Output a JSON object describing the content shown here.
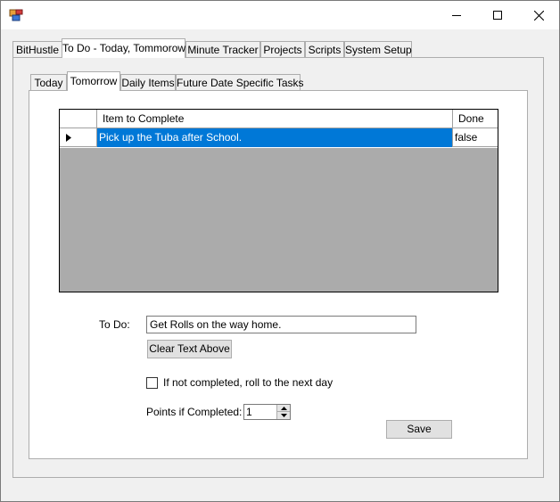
{
  "main_tabs": [
    {
      "label": "BitHustle"
    },
    {
      "label": "To Do - Today, Tommorow"
    },
    {
      "label": "Minute Tracker"
    },
    {
      "label": "Projects"
    },
    {
      "label": "Scripts"
    },
    {
      "label": "System Setup"
    }
  ],
  "sub_tabs": [
    {
      "label": "Today"
    },
    {
      "label": "Tomorrow"
    },
    {
      "label": "Daily Items"
    },
    {
      "label": "Future Date Specific Tasks"
    }
  ],
  "grid": {
    "columns": [
      "Item to Complete",
      "Done"
    ],
    "rows": [
      {
        "item": "Pick up the Tuba after School.",
        "done": "false"
      }
    ]
  },
  "form": {
    "todo_label": "To Do:",
    "todo_value": "Get Rolls on the way home.",
    "clear_button": "Clear Text Above",
    "roll_label": "If not completed, roll to the next day",
    "points_label": "Points if Completed:",
    "points_value": "1",
    "save_button": "Save"
  },
  "colors": {
    "selection": "#0078d7",
    "grid_background": "#ababab"
  }
}
